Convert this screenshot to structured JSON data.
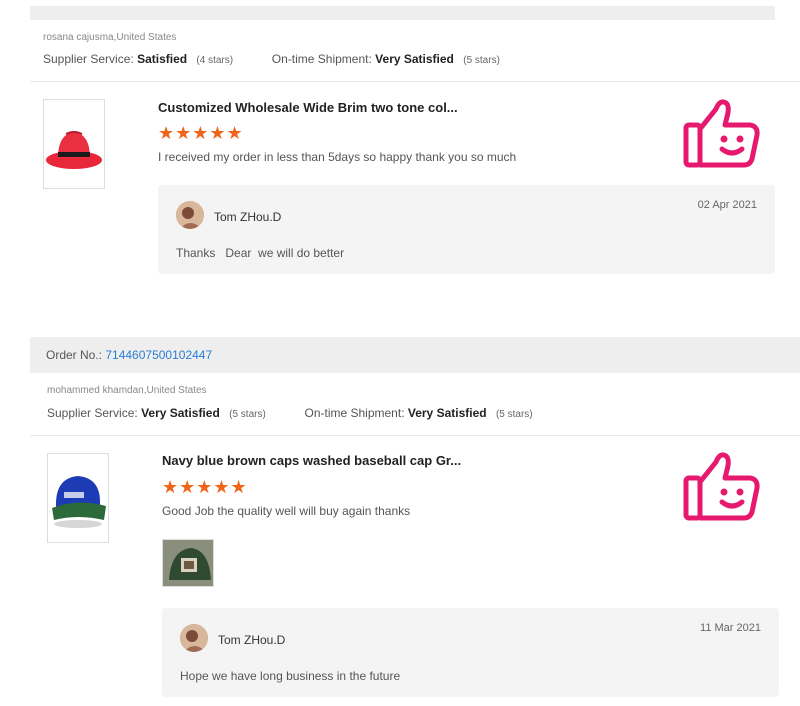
{
  "colors": {
    "accent_star": "#f0651a",
    "like_icon": "#e6196e",
    "order_link": "#2a7dd1",
    "bar_bg": "#eeeeee"
  },
  "reviews": [
    {
      "buyer": "rosana cajusma,United States",
      "supplier_service_label": "Supplier Service:",
      "supplier_service_value": "Satisfied",
      "supplier_service_stars": "(4 stars)",
      "shipment_label": "On-time Shipment:",
      "shipment_value": "Very Satisfied",
      "shipment_stars": "(5 stars)",
      "product_title": "Customized Wholesale Wide Brim two tone col...",
      "rating": 5,
      "stars": "★★★★★",
      "comment": "I received my order in less than 5days so happy thank you so much",
      "icon": "thumbs-up-smile-icon",
      "reply": {
        "name": "Tom ZHou.D",
        "date": "02 Apr 2021",
        "message": "Thanks   Dear  we will do better"
      }
    },
    {
      "order_label": "Order No.:",
      "order_number": "7144607500102447",
      "buyer": "mohammed khamdan,United States",
      "supplier_service_label": "Supplier Service:",
      "supplier_service_value": "Very Satisfied",
      "supplier_service_stars": "(5 stars)",
      "shipment_label": "On-time Shipment:",
      "shipment_value": "Very Satisfied",
      "shipment_stars": "(5 stars)",
      "product_title": "Navy blue brown caps washed baseball cap Gr...",
      "rating": 5,
      "stars": "★★★★★",
      "comment": "Good Job the quality well will buy again thanks",
      "icon": "thumbs-up-smile-icon",
      "reply": {
        "name": "Tom ZHou.D",
        "date": "11 Mar 2021",
        "message": "Hope we have long business in the future"
      }
    }
  ]
}
